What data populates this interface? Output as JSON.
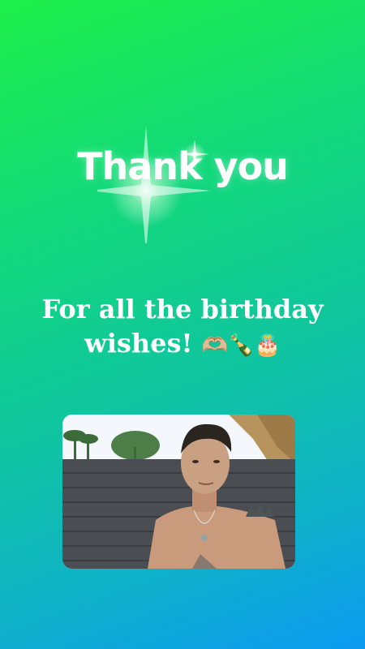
{
  "story": {
    "headline": "Thank you",
    "subtitle_line1": "For all the birthday",
    "subtitle_line2": "wishes!",
    "subtitle_emojis": "🫶🏼🍾🎂",
    "photo_icon": "person-photo"
  },
  "colors": {
    "gradient_top": "#1ef04a",
    "gradient_bottom": "#0d9bf2",
    "text": "#ffffff"
  }
}
